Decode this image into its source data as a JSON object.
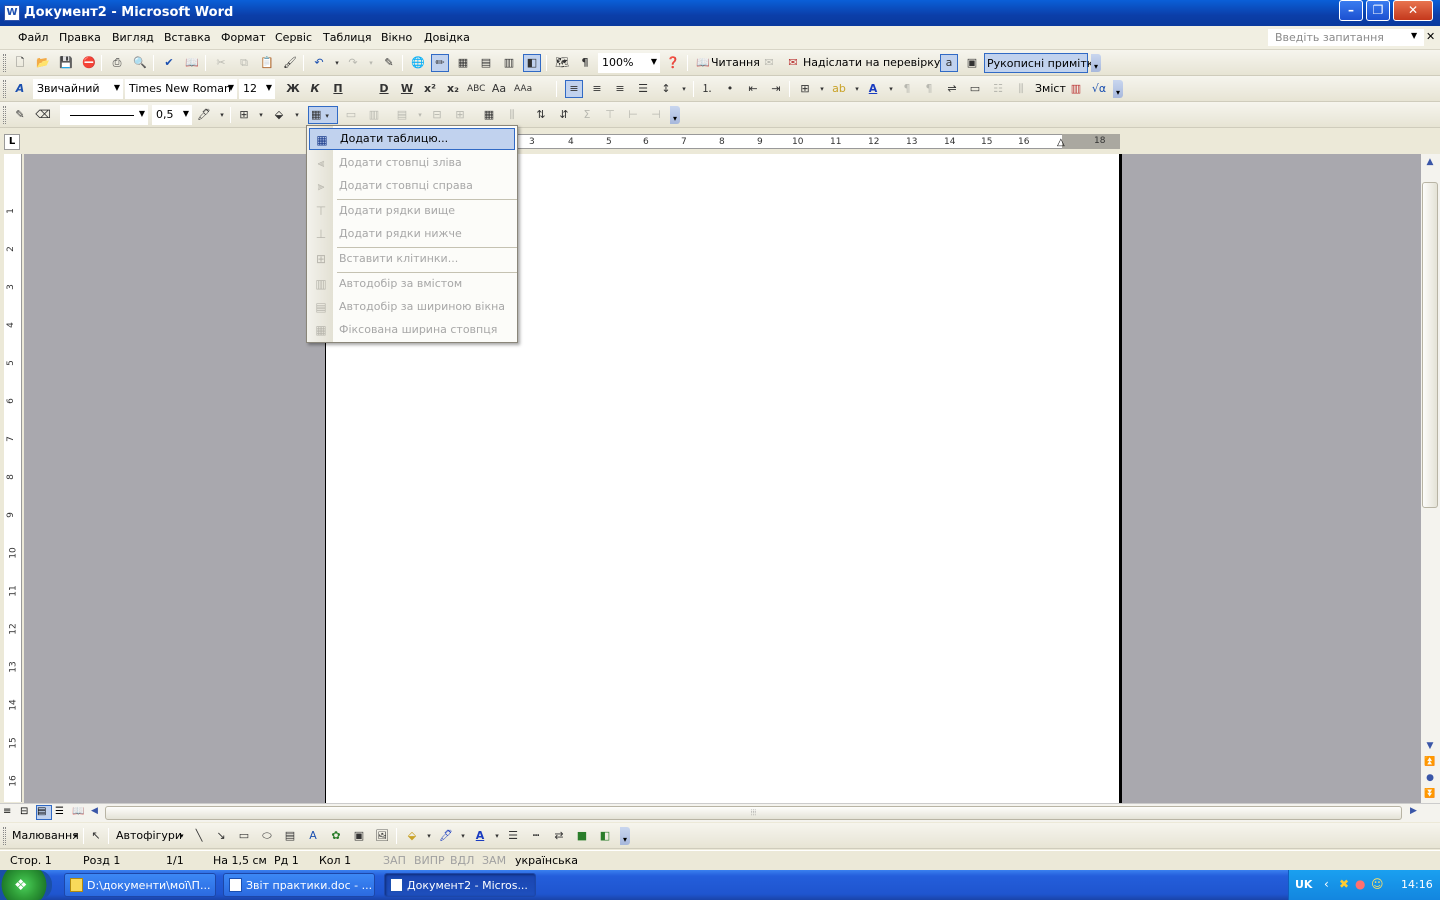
{
  "window": {
    "title": "Документ2 - Microsoft Word",
    "app_icon": "W"
  },
  "menu": {
    "items": [
      "Файл",
      "Правка",
      "Вигляд",
      "Вставка",
      "Формат",
      "Сервіс",
      "Таблиця",
      "Вікно",
      "Довідка"
    ],
    "ask_question": "Введіть запитання"
  },
  "standard_toolbar": {
    "zoom": "100%",
    "reading_label": "Читання",
    "send_review_label": "Надіслати на перевірку...",
    "ink_annotations_label": "Рукописні примітки"
  },
  "formatting_toolbar": {
    "style": "Звичайний",
    "font": "Times New Roman",
    "size": "12",
    "toc_label": "Зміст"
  },
  "tables_toolbar": {
    "line_weight": "0,5"
  },
  "ruler": {
    "h_ticks": [
      "3",
      "4",
      "5",
      "6",
      "7",
      "8",
      "9",
      "10",
      "11",
      "12",
      "13",
      "14",
      "15",
      "16",
      "18"
    ],
    "v_ticks": [
      "1",
      "2",
      "3",
      "4",
      "5",
      "6",
      "7",
      "8",
      "9",
      "10",
      "11",
      "12",
      "13",
      "14",
      "15",
      "16"
    ]
  },
  "insert_menu": {
    "items": [
      {
        "label": "Додати таблицю...",
        "enabled": true,
        "highlighted": true
      },
      {
        "label": "Додати стовпці зліва",
        "enabled": false
      },
      {
        "label": "Додати стовпці справа",
        "enabled": false
      },
      {
        "label": "Додати рядки вище",
        "enabled": false
      },
      {
        "label": "Додати рядки нижче",
        "enabled": false
      },
      {
        "label": "Вставити клітинки...",
        "enabled": false
      },
      {
        "label": "Автодобір за вмістом",
        "enabled": false
      },
      {
        "label": "Автодобір за шириною вікна",
        "enabled": false
      },
      {
        "label": "Фіксована ширина стовпця",
        "enabled": false
      }
    ]
  },
  "drawing_toolbar": {
    "drawing_label": "Малювання",
    "autoshapes_label": "Автофігури"
  },
  "status_bar": {
    "page": "Стор.  1",
    "section": "Розд  1",
    "pages": "1/1",
    "at": "На  1,5 см",
    "line": "Рд  1",
    "col": "Кол  1",
    "rec": "ЗАП",
    "trk": "ВИПР",
    "ext": "ВДЛ",
    "ovr": "ЗАМ",
    "language": "українська"
  },
  "taskbar": {
    "tasks": [
      "D:\\документи\\мої\\П...",
      "Звіт практики.doc - ...",
      "Документ2 - Micros..."
    ],
    "lang": "UK",
    "clock": "14:16"
  }
}
